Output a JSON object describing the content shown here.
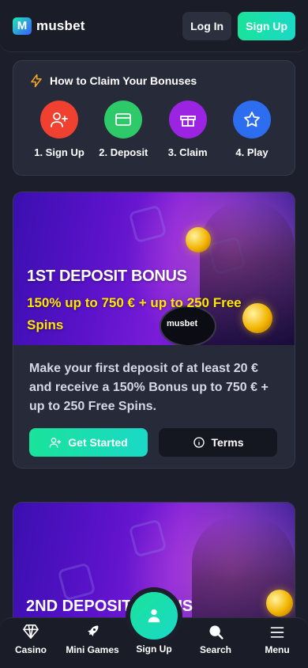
{
  "header": {
    "logo_text": "musbet",
    "logo_mark": "M",
    "login_label": "Log In",
    "signup_label": "Sign Up"
  },
  "steps": {
    "title": "How to Claim Your Bonuses",
    "items": [
      {
        "label": "1. Sign Up",
        "icon": "user-plus-icon",
        "color": "#f0402f"
      },
      {
        "label": "2. Deposit",
        "icon": "credit-card-icon",
        "color": "#2ec968"
      },
      {
        "label": "3. Claim",
        "icon": "gift-icon",
        "color": "#9b24e3"
      },
      {
        "label": "4. Play",
        "icon": "star-icon",
        "color": "#2d6ef0"
      }
    ]
  },
  "bonus1": {
    "title": "1ST DEPOSIT BONUS",
    "subtitle": "150% up to 750 € + up to 250 Free Spins",
    "drum_brand": "musbet",
    "description": "Make your first deposit of at least 20 € and receive a 150% Bonus up to 750 € + up to 250 Free Spins.",
    "cta_label": "Get Started",
    "terms_label": "Terms"
  },
  "bonus2": {
    "title": "2ND DEPOSIT BONUS"
  },
  "bottom_nav": {
    "casino": "Casino",
    "mini_games": "Mini Games",
    "sign_up": "Sign Up",
    "search": "Search",
    "menu": "Menu"
  },
  "colors": {
    "accent": "#19e39b",
    "background": "#1c1e2b",
    "card": "#262a39",
    "highlight": "#ffe600"
  }
}
